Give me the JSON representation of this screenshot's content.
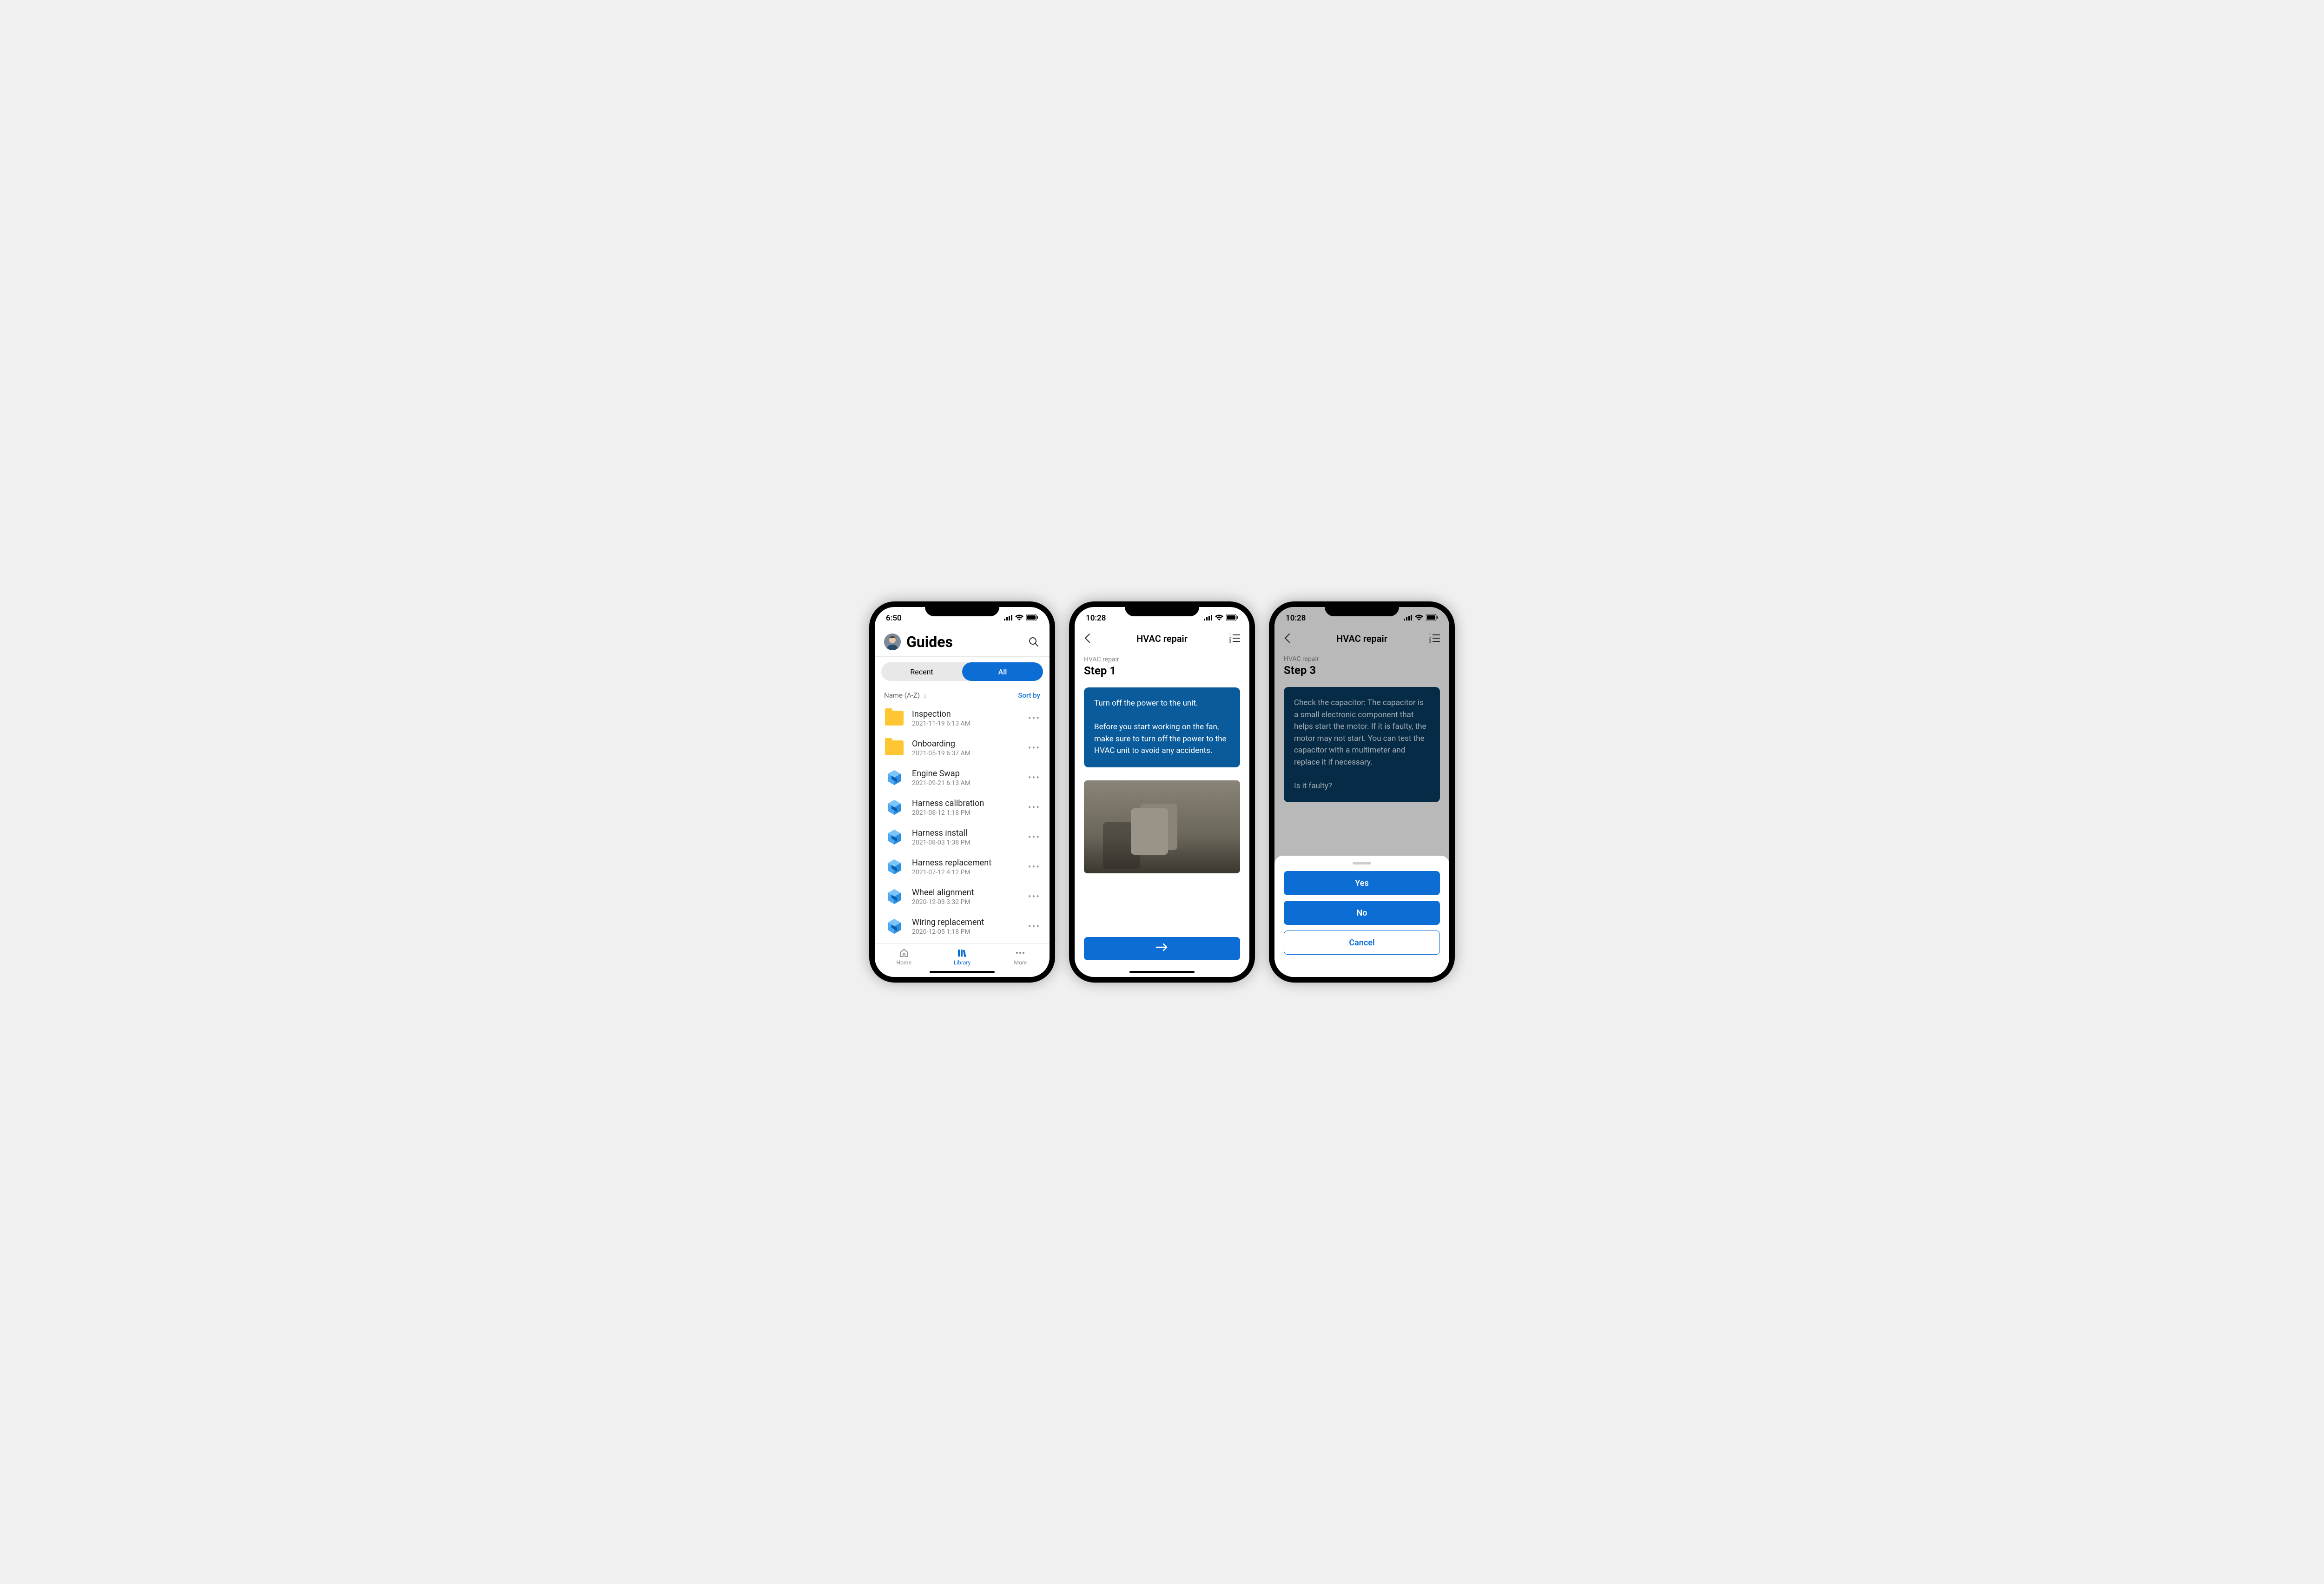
{
  "phone1": {
    "time": "6:50",
    "title": "Guides",
    "tabs": {
      "recent": "Recent",
      "all": "All"
    },
    "sort_label": "Name (A-Z)",
    "sort_by": "Sort by",
    "items": [
      {
        "title": "Inspection",
        "date": "2021-11-19 6:13 AM",
        "type": "folder"
      },
      {
        "title": "Onboarding",
        "date": "2021-05-19 6:37 AM",
        "type": "folder"
      },
      {
        "title": "Engine Swap",
        "date": "2021-09-21 6:13 AM",
        "type": "guide"
      },
      {
        "title": "Harness calibration",
        "date": "2021-08-12 1:18 PM",
        "type": "guide"
      },
      {
        "title": "Harness install",
        "date": "2021-08-03 1:38 PM",
        "type": "guide"
      },
      {
        "title": "Harness replacement",
        "date": "2021-07-12 4:12 PM",
        "type": "guide"
      },
      {
        "title": "Wheel alignment",
        "date": "2020-12-03 3:32 PM",
        "type": "guide"
      },
      {
        "title": "Wiring replacement",
        "date": "2020-12-05 1:18 PM",
        "type": "guide"
      }
    ],
    "nav": {
      "home": "Home",
      "library": "Library",
      "more": "More"
    }
  },
  "phone2": {
    "time": "10:28",
    "title": "HVAC repair",
    "sub": "HVAC repair",
    "step": "Step 1",
    "body": "Turn off the power to the unit.\n\nBefore you start working on the fan, make sure to turn off the power to the HVAC unit to avoid any accidents."
  },
  "phone3": {
    "time": "10:28",
    "title": "HVAC repair",
    "sub": "HVAC repair",
    "step": "Step 3",
    "body": "Check the capacitor: The capacitor is a small electronic component that helps start the motor. If it is faulty, the motor may not start. You can test the capacitor with a multimeter and replace it if necessary.\n\nIs it faulty?",
    "sheet": {
      "yes": "Yes",
      "no": "No",
      "cancel": "Cancel"
    }
  }
}
